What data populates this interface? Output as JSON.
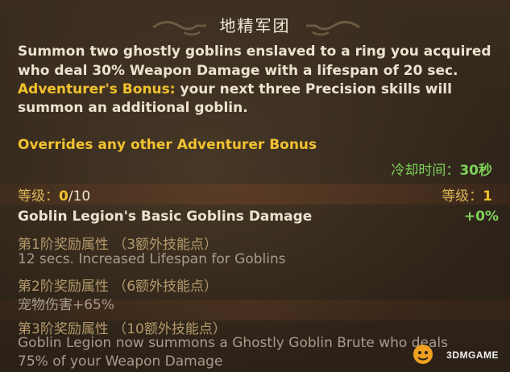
{
  "tooltip": {
    "title": "地精军团",
    "desc_line1": "Summon two ghostly goblins enslaved to a ring you acquired",
    "desc_line2": "who deal 30% Weapon Damage  with a lifespan of 20 sec.",
    "bonus_label": "Adventurer's Bonus:",
    "bonus_text": " your next three Precision skills will",
    "bonus_line2": "summon an additional goblin.",
    "override": "Overrides any other Adventurer Bonus",
    "cooldown_label": "冷却时间：",
    "cooldown_value": "30秒",
    "level_label": "等级：",
    "level_current": "0",
    "level_max": "/10",
    "req_level_label": "等级：",
    "req_level_value": "1",
    "stat_name": "Goblin Legion's Basic Goblins Damage",
    "stat_value": "+0%",
    "tiers": [
      {
        "label": "第1阶奖励属性 （3额外技能点）",
        "effect": "12 secs. Increased Lifespan for Goblins"
      },
      {
        "label": "第2阶奖励属性 （6额外技能点）",
        "effect": "宠物伤害+65%"
      },
      {
        "label": "第3阶奖励属性 （10额外技能点）",
        "effect": "Goblin Legion now summons a Ghostly Goblin Brute who deals",
        "effect2": "75% of your Weapon Damage"
      }
    ]
  },
  "watermark": {
    "text": "3DMGAME"
  },
  "colors": {
    "gold": "#f2c230",
    "green": "#7fd05a",
    "cream": "#ede2cf",
    "muted": "#a79d8d"
  }
}
